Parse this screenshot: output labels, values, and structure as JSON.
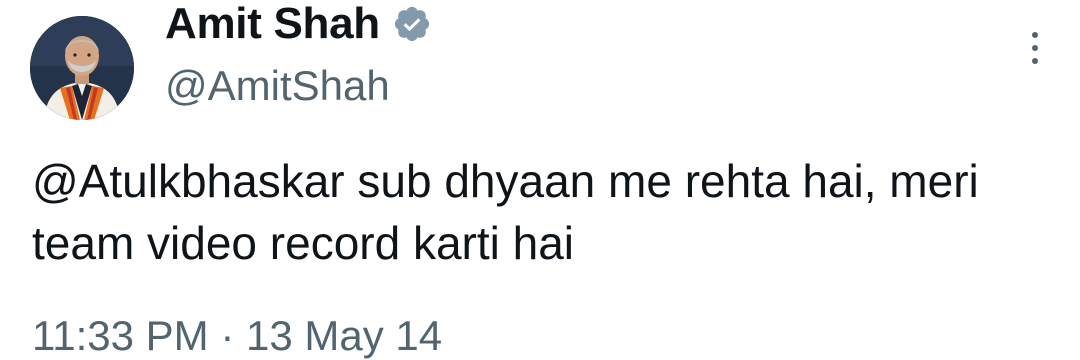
{
  "author": {
    "display_name": "Amit Shah",
    "handle": "@AmitShah",
    "verified_icon": "verified-badge-icon",
    "verified_color": "#829aab"
  },
  "tweet": {
    "mention": "@Atulkbhaskar",
    "text": " sub dhyaan me rehta hai, meri team video record karti hai"
  },
  "meta": {
    "time": "11:33 PM",
    "separator": " · ",
    "date": "13 May 14"
  },
  "menu": {
    "icon": "more-options-icon"
  },
  "colors": {
    "text_primary": "#0f1419",
    "text_secondary": "#536471",
    "background": "#ffffff"
  }
}
